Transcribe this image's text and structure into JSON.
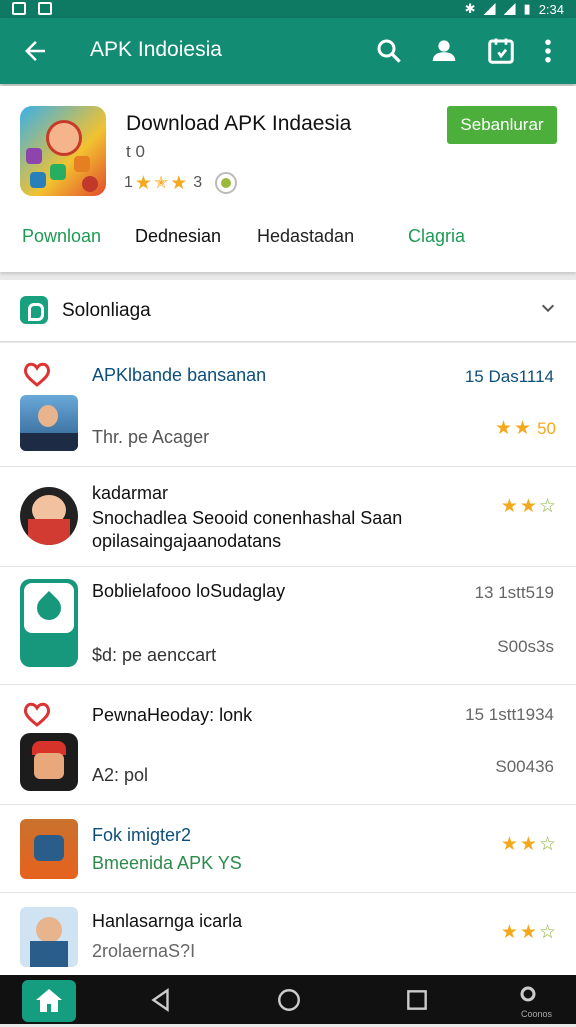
{
  "status": {
    "time": "2:34"
  },
  "appbar": {
    "title": "APK Indoiesia"
  },
  "app": {
    "name": "Download APK Indaesia",
    "version": "t 0",
    "rating_left": "1",
    "rating_right": "3",
    "install_label": "Sebanlurar"
  },
  "tabs": [
    "Pownloan",
    "Dednesian",
    "Hedastadan",
    "Clagria"
  ],
  "section": {
    "title": "Solonliaga"
  },
  "rows": [
    {
      "title": "APKlbande bansanan",
      "sub": "Thr. pe Acager",
      "right_top": "15 Das1114",
      "right_bottom": "50"
    },
    {
      "title": "kadarmar",
      "line2": "Snochadlea Seooid conenhashal Saan",
      "line3": "opilasaingajaanodatans"
    },
    {
      "title": "Boblielafooo loSudaglay",
      "sub": "$d: pe aenccart",
      "right_top": "13 1stt519",
      "right_bottom": "S00s3s"
    },
    {
      "title": "PewnaHeoday: lonk",
      "sub": "A2: pol",
      "right_top": "15 1stt1934",
      "right_bottom": "S00436"
    },
    {
      "title": "Fok imigter2",
      "sub": "Bmeenida APK YS"
    },
    {
      "title": "Hanlasarnga icarla",
      "sub": "2rolaernaS?I"
    }
  ],
  "nav": {
    "label": "Coonos"
  },
  "colors": {
    "primary": "#128c72",
    "accent": "#4caf3c",
    "star": "#f4a81d"
  }
}
